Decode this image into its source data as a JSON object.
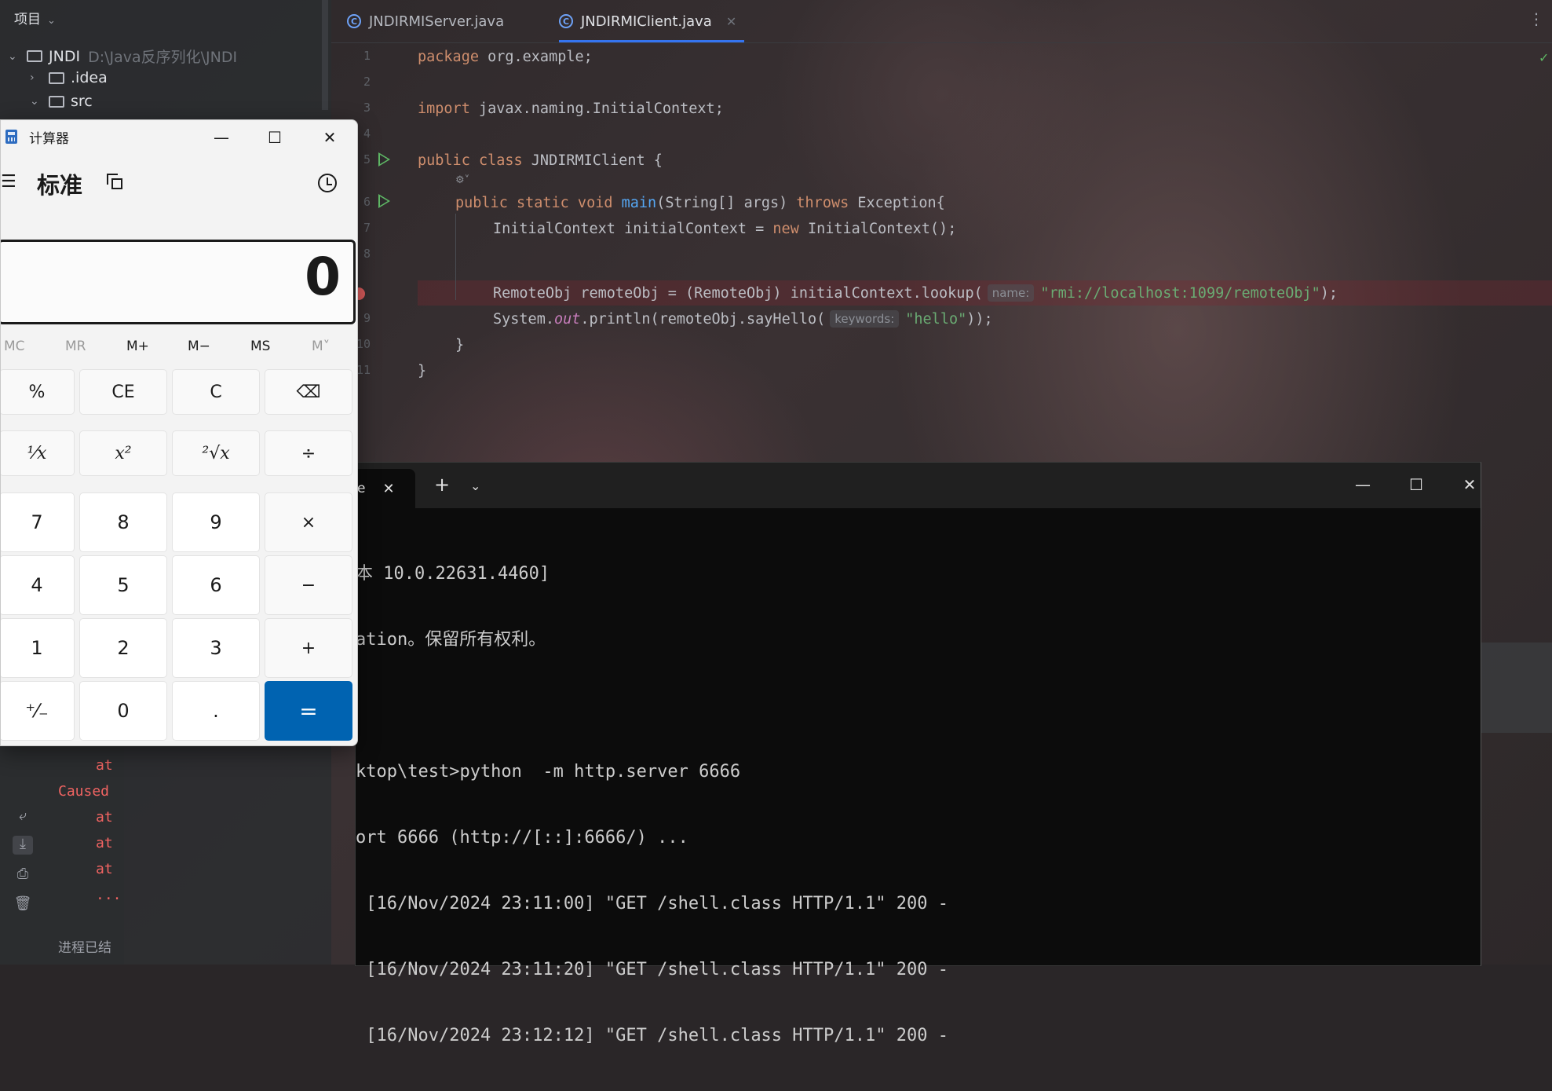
{
  "ide": {
    "project_header": "项目",
    "tree": [
      {
        "name": "JNDI",
        "path": "D:\\Java反序列化\\JNDI"
      },
      {
        "name": ".idea"
      },
      {
        "name": "src"
      }
    ],
    "tabs": [
      {
        "label": "JNDIRMIServer.java"
      },
      {
        "label": "JNDIRMIClient.java"
      }
    ],
    "code": {
      "line1": {
        "num": "1",
        "kw": "package",
        "rest": " org.example;"
      },
      "line2": {
        "num": "2"
      },
      "line3": {
        "num": "3",
        "kw": "import",
        "rest": " javax.naming.InitialContext;"
      },
      "line4": {
        "num": "4"
      },
      "line5": {
        "num": "5",
        "kw": "public class",
        "rest": " JNDIRMIClient {"
      },
      "line6": {
        "num": "6",
        "kw1": "public static void",
        "fn": "main",
        "mid": "(String[] args) ",
        "kw2": "throws",
        "rest": " Exception{"
      },
      "line7": {
        "num": "7",
        "pre": "InitialContext initialContext = ",
        "kw": "new",
        "rest": " InitialContext();"
      },
      "line8": {
        "num": "8",
        "pre": "RemoteObj remoteObj = (RemoteObj) initialContext.lookup(",
        "hint": "name:",
        "str": "\"rmi://localhost:1099/remoteObj\"",
        "rest": ");"
      },
      "line9": {
        "num": "9",
        "pre": "System.",
        "static": "out",
        "mid": ".println(remoteObj.sayHello(",
        "hint": "keywords:",
        "str": "\"hello\"",
        "rest": "));"
      },
      "line10": {
        "num": "10",
        "text": "}"
      },
      "line11": {
        "num": "11",
        "text": "}"
      },
      "lens": "⚙˅"
    },
    "run_output": {
      "lines": [
        "at",
        "Caused",
        "at",
        "at",
        "at",
        "..."
      ],
      "done": "进程已结"
    }
  },
  "terminal": {
    "tab_label": "e",
    "lines": [
      "本 10.0.22631.4460]",
      "ation。保留所有权利。",
      "",
      "ktop\\test>python  -m http.server 6666",
      "ort 6666 (http://[::]:6666/) ...",
      " [16/Nov/2024 23:11:00] \"GET /shell.class HTTP/1.1\" 200 -",
      " [16/Nov/2024 23:11:20] \"GET /shell.class HTTP/1.1\" 200 -",
      " [16/Nov/2024 23:12:12] \"GET /shell.class HTTP/1.1\" 200 -"
    ]
  },
  "calculator": {
    "title": "计算器",
    "mode": "标准",
    "display": "0",
    "memory": [
      "MC",
      "MR",
      "M+",
      "M−",
      "MS",
      "M˅"
    ],
    "keys": [
      [
        "%",
        "CE",
        "C",
        "⌫"
      ],
      [
        "¹⁄x",
        "x²",
        "²√x",
        "÷"
      ],
      [
        "7",
        "8",
        "9",
        "×"
      ],
      [
        "4",
        "5",
        "6",
        "−"
      ],
      [
        "1",
        "2",
        "3",
        "+"
      ],
      [
        "⁺⁄₋",
        "0",
        ".",
        "="
      ]
    ]
  },
  "colors": {
    "accent": "#3574f0",
    "equals": "#0063b1",
    "breakpoint": "#db5c5c"
  }
}
